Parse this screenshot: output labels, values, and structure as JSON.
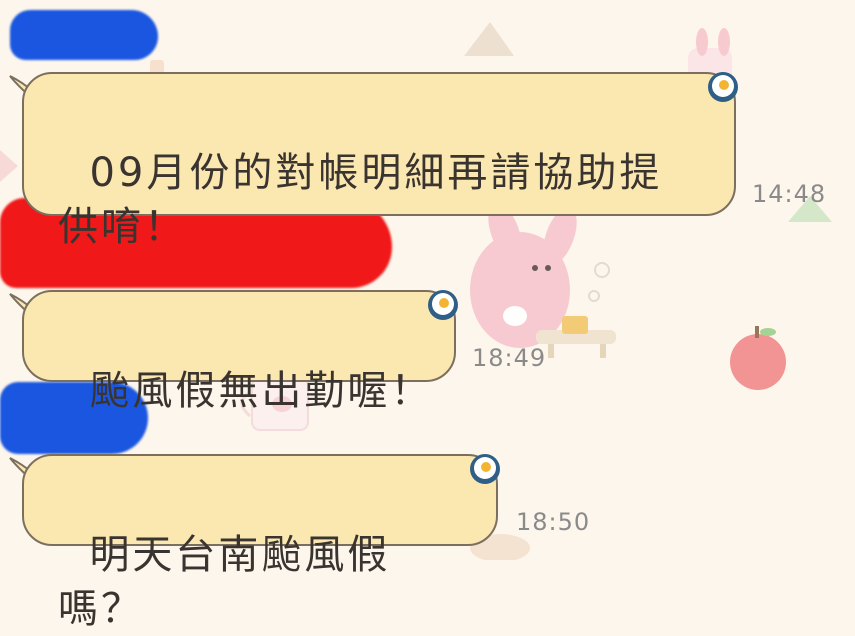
{
  "chat": {
    "messages": [
      {
        "text": "09月份的對帳明細再請協助提供唷！",
        "time": "14:48"
      },
      {
        "text": "颱風假無出勤喔！",
        "time": "18:49"
      },
      {
        "text": "明天台南颱風假嗎？",
        "time": "18:50"
      }
    ],
    "colors": {
      "bubble": "#fbe8b0",
      "bubble_border": "#7c6f5e",
      "background": "#fdf6ec",
      "redaction_blue": "#1a56e0",
      "redaction_red": "#f01818"
    }
  }
}
